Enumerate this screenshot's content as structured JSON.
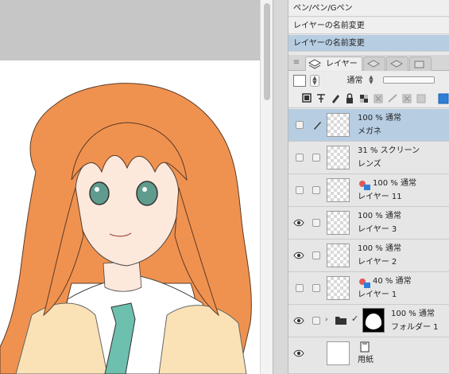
{
  "history": {
    "items": [
      {
        "label": "ペン/ペン/Gペン",
        "selected": false
      },
      {
        "label": "レイヤーの名前変更",
        "selected": false
      },
      {
        "label": "レイヤーの名前変更",
        "selected": true
      }
    ]
  },
  "tabs": {
    "layer_label": "レイヤー"
  },
  "layer_properties": {
    "blend_mode": "通常"
  },
  "layers": [
    {
      "mode": "100 % 通常",
      "name": "メガネ",
      "visible": false,
      "selected": true,
      "editing": true,
      "kind": "raster"
    },
    {
      "mode": "31 % スクリーン",
      "name": "レンズ",
      "visible": false,
      "selected": false,
      "kind": "raster"
    },
    {
      "mode": "100 % 通常",
      "name": "レイヤー 11",
      "visible": false,
      "selected": false,
      "kind": "raster-colored"
    },
    {
      "mode": "100 % 通常",
      "name": "レイヤー 3",
      "visible": true,
      "selected": false,
      "kind": "raster"
    },
    {
      "mode": "100 % 通常",
      "name": "レイヤー 2",
      "visible": true,
      "selected": false,
      "kind": "raster"
    },
    {
      "mode": "40 % 通常",
      "name": "レイヤー 1",
      "visible": false,
      "selected": false,
      "kind": "raster-colored"
    },
    {
      "mode": "100 % 通常",
      "name": "フォルダー 1",
      "visible": true,
      "selected": false,
      "kind": "folder"
    },
    {
      "mode": "",
      "name": "用紙",
      "visible": true,
      "selected": false,
      "kind": "paper"
    }
  ],
  "colors": {
    "selection": "#b7cde2",
    "hair": "#f0924f",
    "eyes": "#5f9c8e",
    "tie": "#6dbfae",
    "cardigan": "#fbe2b6"
  },
  "icons": {
    "eye": "eye-icon",
    "pen": "pen-icon",
    "folder": "folder-icon",
    "paper": "paper-icon"
  }
}
